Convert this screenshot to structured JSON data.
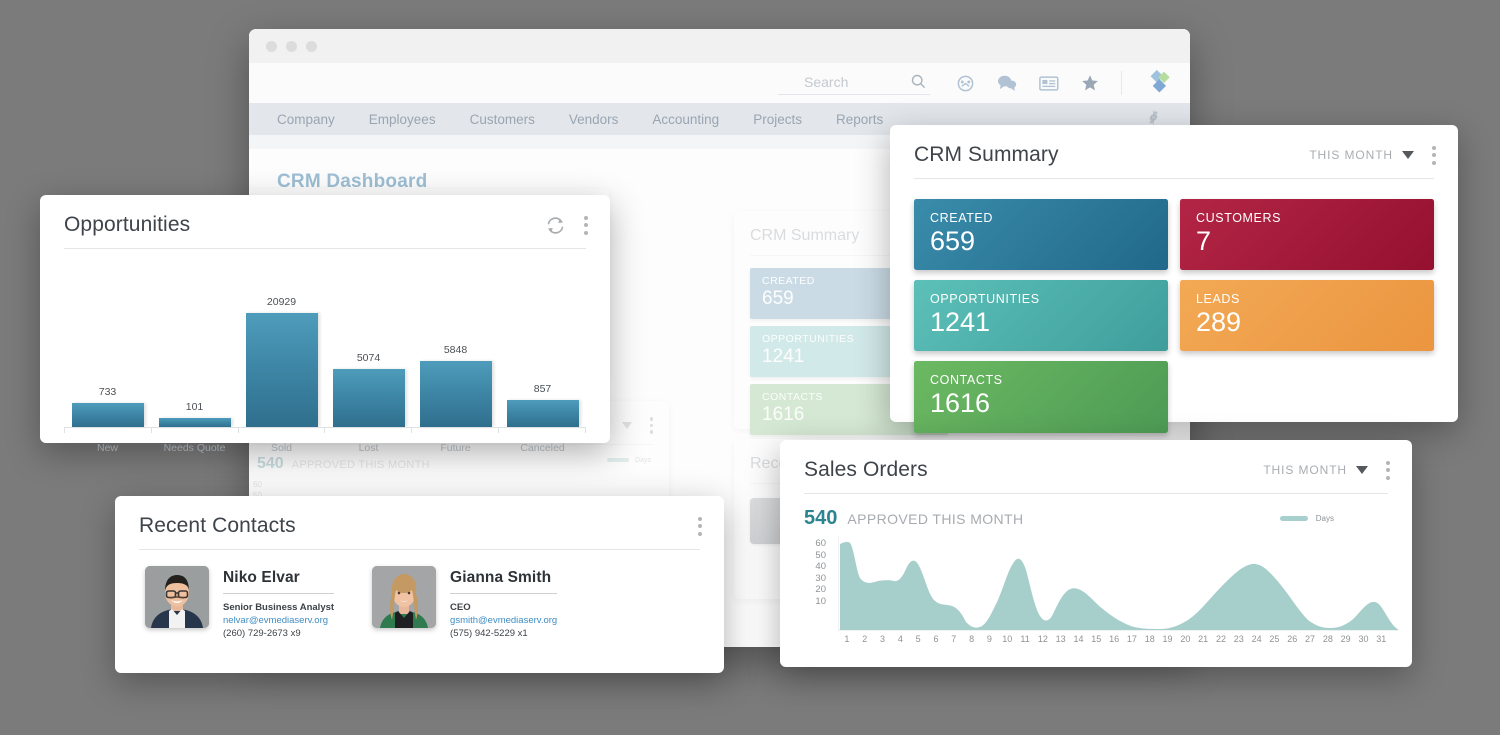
{
  "browser": {
    "search": {
      "placeholder": "Search",
      "value": ""
    },
    "toolbar_icons": [
      "gauge-icon",
      "chat-icon",
      "card-icon",
      "star-icon",
      "diamond-logo-icon"
    ],
    "nav_items": [
      "Company",
      "Employees",
      "Customers",
      "Vendors",
      "Accounting",
      "Projects",
      "Reports"
    ],
    "settings_icon": "gear-icon",
    "page_title": "CRM Dashboard"
  },
  "opportunities": {
    "title": "Opportunities",
    "refresh_icon": "refresh-icon",
    "menu_icon": "kebab-menu-icon"
  },
  "crm_summary": {
    "title": "CRM Summary",
    "period": "THIS MONTH",
    "menu_icon": "kebab-menu-icon",
    "tiles": [
      {
        "label": "CREATED",
        "value": "659",
        "color": "#2c7d9e"
      },
      {
        "label": "CUSTOMERS",
        "value": "7",
        "color": "#a81c3c"
      },
      {
        "label": "OPPORTUNITIES",
        "value": "1241",
        "color": "#4cb3ae"
      },
      {
        "label": "LEADS",
        "value": "289",
        "color": "#f0a04b"
      },
      {
        "label": "CONTACTS",
        "value": "1616",
        "color": "#5cab5c"
      }
    ]
  },
  "sales_orders": {
    "title": "Sales Orders",
    "period": "THIS MONTH",
    "menu_icon": "kebab-menu-icon",
    "stat_value": "540",
    "stat_label": "APPROVED THIS MONTH",
    "legend_label": "Days"
  },
  "recent_contacts": {
    "title": "Recent Contacts",
    "menu_icon": "kebab-menu-icon",
    "contacts": [
      {
        "name": "Niko Elvar",
        "role": "Senior Business Analyst",
        "email": "nelvar@evmediaserv.org",
        "phone": "(260) 729-2673 x9",
        "avatar": "male-portrait-avatar"
      },
      {
        "name": "Gianna Smith",
        "role": "CEO",
        "email": "gsmith@evmediaserv.org",
        "phone": "(575) 942-5229 x1",
        "avatar": "female-portrait-avatar"
      }
    ]
  },
  "chart_data": [
    {
      "type": "bar",
      "title": "Opportunities",
      "categories": [
        "New",
        "Needs Quote",
        "Sold",
        "Lost",
        "Future",
        "Canceled"
      ],
      "values": [
        733,
        101,
        20929,
        5074,
        5848,
        857
      ],
      "xlabel": "",
      "ylabel": "",
      "ylim": [
        0,
        20929
      ],
      "grid": false,
      "legend": "none",
      "series_color": "#3f87a7"
    },
    {
      "type": "area",
      "title": "Sales Orders",
      "subtitle": "540 APPROVED THIS MONTH",
      "xlabel": "",
      "ylabel": "",
      "ylim": [
        0,
        65
      ],
      "yticks": [
        10,
        20,
        30,
        40,
        50,
        60
      ],
      "x": [
        1,
        2,
        3,
        4,
        5,
        6,
        7,
        8,
        9,
        10,
        11,
        12,
        13,
        14,
        15,
        16,
        17,
        18,
        19,
        20,
        21,
        22,
        23,
        24,
        25,
        26,
        27,
        28,
        29,
        30,
        31
      ],
      "series": [
        {
          "name": "Days",
          "color": "#a6d0cd",
          "values": [
            60,
            33,
            32,
            32,
            44,
            22,
            18,
            3,
            14,
            50,
            17,
            36,
            33,
            24,
            15,
            8,
            2,
            2,
            5,
            11,
            22,
            37,
            44,
            38,
            22,
            3,
            5,
            12,
            21,
            9,
            1
          ]
        }
      ],
      "grid": false,
      "legend": "top-right"
    }
  ]
}
